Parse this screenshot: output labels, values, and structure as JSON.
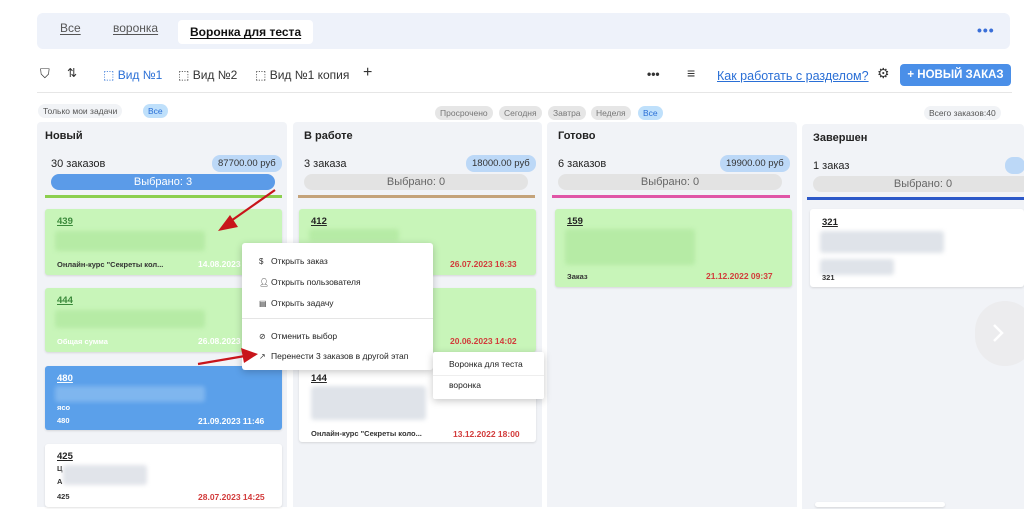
{
  "tabs": {
    "all": "Все",
    "funnel": "воронка",
    "test": "Воронка для теста"
  },
  "toolbar": {
    "view1": "Вид №1",
    "view2": "Вид №2",
    "view1_copy": "Вид №1 копия",
    "add": "+",
    "more": "•••",
    "list": "≡",
    "help": "Как работать с разделом?",
    "new_order": "+ НОВЫЙ ЗАКАЗ"
  },
  "filters": {
    "only_mine": "Только мои задачи",
    "all": "Все",
    "overdue": "Просрочено",
    "today": "Сегодня",
    "tomorrow": "Завтра",
    "week": "Неделя",
    "all2": "Все",
    "total_orders": "Всего заказов:40"
  },
  "columns": [
    {
      "title": "Новый",
      "count": "30 заказов",
      "sum": "87700.00 руб",
      "selected": "Выбрано: 3",
      "color": "#8ccf4f"
    },
    {
      "title": "В работе",
      "count": "3 заказа",
      "sum": "18000.00 руб",
      "selected": "Выбрано: 0",
      "color": "#c4a37a"
    },
    {
      "title": "Готово",
      "count": "6 заказов",
      "sum": "19900.00 руб",
      "selected": "Выбрано: 0",
      "color": "#e055a6"
    },
    {
      "title": "Завершен",
      "count": "1 заказ",
      "sum": "",
      "selected": "Выбрано: 0",
      "color": "#2c58c8"
    }
  ],
  "cards": {
    "c439": {
      "id": "439",
      "foot": "Онлайн-курс \"Секреты кол...",
      "date": "14.08.2023"
    },
    "c444": {
      "id": "444",
      "foot": "Общая сумма",
      "date": "26.08.2023"
    },
    "c480": {
      "id": "480",
      "mid": "ясо",
      "foot": "480",
      "date": "21.09.2023 11:46"
    },
    "c425": {
      "id": "425",
      "l1": "Ц",
      "l2": "А",
      "foot": "425",
      "date": "28.07.2023 14:25"
    },
    "c412": {
      "id": "412",
      "date": "26.07.2023 16:33"
    },
    "c_mid": {
      "date": "20.06.2023 14:02"
    },
    "c144": {
      "id": "144",
      "foot": "Онлайн-курс \"Секреты коло...",
      "date": "13.12.2022 18:00"
    },
    "c159": {
      "id": "159",
      "foot": "Заказ",
      "date": "21.12.2022 09:37"
    },
    "c321": {
      "id": "321",
      "id2": "321"
    }
  },
  "menu": {
    "open_order": "Открыть заказ",
    "open_user": "Открыть пользователя",
    "open_task": "Открыть задачу",
    "cancel_sel": "Отменить выбор",
    "move": "Перенести 3 заказов в другой этап"
  },
  "submenu": {
    "test": "Воронка для теста",
    "funnel": "воронка"
  },
  "colors": {
    "accent": "#4a8fe8",
    "arrow": "#c8151b",
    "green_card": "#c8f5b9",
    "blue_card": "#5ba0ea"
  }
}
